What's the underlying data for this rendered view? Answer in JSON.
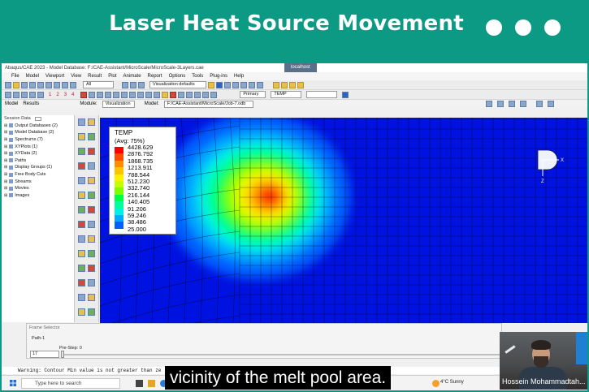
{
  "banner": {
    "title": "Laser Heat Source Movement"
  },
  "window": {
    "title": "Abaqus/CAE 2023 - Model Database: F:/CAE-Assistant/MicroScale/MicroScale-3Layers.cae",
    "center_tab": "localhost"
  },
  "menu": [
    "File",
    "Model",
    "Viewport",
    "View",
    "Result",
    "Plot",
    "Animate",
    "Report",
    "Options",
    "Tools",
    "Plug-ins",
    "Help"
  ],
  "toolbar": {
    "all_combo": "All",
    "vis_defaults": "Visualization defaults",
    "primary_combo": "Primary",
    "var_combo": "TEMP",
    "steps": [
      "1",
      "2",
      "3",
      "4"
    ]
  },
  "context_bar": {
    "module_label": "Module:",
    "module_value": "Visualization",
    "model_label": "Model:",
    "model_value": "F:/CAE-Assistant/MicroScale/Job-7.odb"
  },
  "tabs": {
    "model": "Model",
    "results": "Results"
  },
  "session": {
    "label": "Session Data"
  },
  "tree": [
    {
      "label": "Output Databases (2)"
    },
    {
      "label": "Model Database (2)"
    },
    {
      "label": "Spectrums (7)"
    },
    {
      "label": "XYPlots (1)"
    },
    {
      "label": "XYData (2)"
    },
    {
      "label": "Paths"
    },
    {
      "label": "Display Groups (1)"
    },
    {
      "label": "Free Body Cuts"
    },
    {
      "label": "Streams"
    },
    {
      "label": "Movies"
    },
    {
      "label": "Images"
    }
  ],
  "legend": {
    "title": "TEMP",
    "subtitle": "(Avg: 75%)",
    "values": [
      "4428.629",
      "2876.792",
      "1868.735",
      "1213.911",
      "788.544",
      "512.230",
      "332.740",
      "216.144",
      "140.405",
      "91.206",
      "59.246",
      "38.486",
      "25.000"
    ],
    "colors": [
      "#ff0000",
      "#ff4a00",
      "#ff8c00",
      "#ffc400",
      "#fff000",
      "#c8ff00",
      "#7dff00",
      "#00ff3c",
      "#00ff9a",
      "#00f0e6",
      "#00aaff",
      "#0060ff",
      "#0012e0"
    ]
  },
  "triad": {
    "x": "X",
    "z": "Z"
  },
  "frame_selector": {
    "title": "Frame Selector",
    "path": "Path-1",
    "prestep": "Pre-Step: 0",
    "frame_value": "17"
  },
  "message": "Warning: Contour Min value is not greater than ze",
  "taskbar": {
    "search": "Type here to search",
    "weather": "4°C  Sunny"
  },
  "caption": "vicinity of the melt pool area.",
  "webcam": {
    "name": "Hossein Mohammadtah..."
  }
}
